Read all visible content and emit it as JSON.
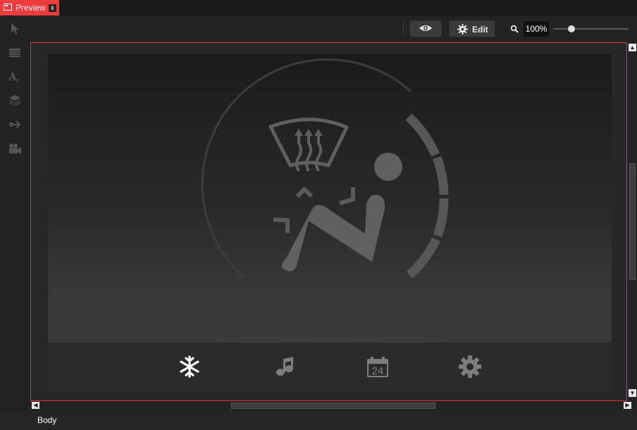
{
  "tab": {
    "label": "Preview",
    "close_glyph": "x"
  },
  "toolbar": {
    "edit_label": "Edit",
    "zoom_value": "100%",
    "zoom_level": 100
  },
  "left_tools": [
    "pointer-icon",
    "table-icon",
    "text-style-icon",
    "layers-icon",
    "connector-icon",
    "camera-icon"
  ],
  "hmi": {
    "nav_icons": [
      "snowflake-icon",
      "music-note-icon",
      "calendar-icon",
      "gear-icon"
    ],
    "calendar_day": "24",
    "accent_active": "#ffffff",
    "accent_inactive": "#7d7d7d"
  },
  "status": {
    "text": "Body"
  },
  "colors": {
    "tab_active": "#ee3b3b",
    "canvas_border": "#e03a3a"
  }
}
